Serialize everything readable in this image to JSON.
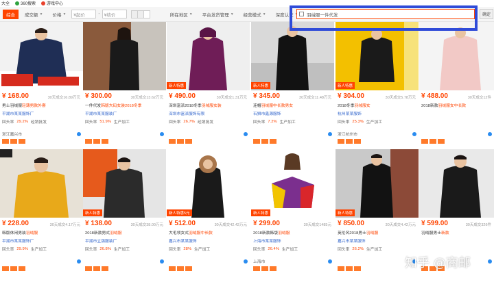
{
  "bookmarks": [
    {
      "label": "大全",
      "color": ""
    },
    {
      "label": "360搜索",
      "color": "#2fa33f"
    },
    {
      "label": "游戏中心",
      "color": "#e8412c"
    }
  ],
  "filters": {
    "sort_default": "综合",
    "sort_sales": "成交额",
    "sort_price": "价格",
    "price_from": "¥起价",
    "price_to": "¥结价",
    "location": "所在地区",
    "platform": "平台发货管理",
    "operation": "经营模式",
    "auth": "深度认证",
    "search_value": "羽绒服一件代发",
    "search_btn": "确定"
  },
  "products": [
    {
      "price": "¥ 168.00",
      "sales": "30天成交16.89万元",
      "title_a": "男士羽绒服",
      "title_b": "轻薄男款外套",
      "shop": "平湖市某某服饰厂",
      "repeat": "回头率",
      "rate": "29.2%",
      "type": "经销批发",
      "loc": "浙江嘉兴市",
      "badge": "",
      "img": "navy-jacket"
    },
    {
      "price": "¥ 300.00",
      "sales": "30天成交13.62万元",
      "title_a": "一件代发",
      "title_b": "韩版大码女装2018冬季",
      "shop": "平湖市某某服装厂",
      "repeat": "回头率",
      "rate": "51.9%",
      "type": "生产加工",
      "loc": "",
      "badge": "",
      "img": "black-coat-girl"
    },
    {
      "price": "¥ 490.00",
      "sales": "30天成交1.31万元",
      "title_a": "深圳富派2018冬季",
      "title_b": "羽绒服女装",
      "shop": "深圳市富派服饰有限",
      "repeat": "回头率",
      "rate": "26.7%",
      "type": "经销批发",
      "loc": "",
      "badge": "新人特惠",
      "img": "purple-parka"
    },
    {
      "price": "¥ 345.00",
      "sales": "30天成交11.48万元",
      "title_a": "连帽",
      "title_b": "羽绒服中长款男女",
      "shop": "石狮市鑫源服饰",
      "repeat": "回头率",
      "rate": "7.2%",
      "type": "生产加工",
      "loc": "",
      "badge": "新人特惠",
      "img": "black-long"
    },
    {
      "price": "¥ 304.00",
      "sales": "30天成交5.78万元",
      "title_a": "2018冬季",
      "title_b": "羽绒服女",
      "shop": "杭州某某服饰",
      "repeat": "回头率",
      "rate": "25.3%",
      "type": "生产加工",
      "loc": "浙江杭州市",
      "badge": "新人特惠",
      "img": "yellow-wall"
    },
    {
      "price": "¥ 488.00",
      "sales": "30天成交12件",
      "title_a": "2018新款",
      "title_b": "羽绒服女中长款",
      "shop": "",
      "repeat": "",
      "rate": "",
      "type": "",
      "loc": "",
      "badge": "",
      "img": "pink-coat"
    },
    {
      "price": "¥ 228.00",
      "sales": "30天成交4.17万元",
      "title_a": "韩版休闲男装",
      "title_b": "羽绒服",
      "shop": "平湖市某某服饰厂",
      "repeat": "回头率",
      "rate": "29.9%",
      "type": "生产加工",
      "loc": "",
      "badge": "",
      "img": "yellow-jacket"
    },
    {
      "price": "¥ 138.00",
      "sales": "30天成交38.00万元",
      "title_a": "2018新款男式",
      "title_b": "羽绒服",
      "shop": "平湖市立强服装厂",
      "repeat": "回头率",
      "rate": "26.8%",
      "type": "生产加工",
      "loc": "",
      "badge": "新人特惠",
      "img": "black-puffer"
    },
    {
      "price": "¥ 512.00",
      "sales": "30天成交42.42万元",
      "title_a": "大毛领女式",
      "title_b": "羽绒服中长款",
      "shop": "嘉兴市某某服饰",
      "repeat": "回头率",
      "rate": "28%",
      "type": "生产加工",
      "loc": "",
      "badge": "新人特惠5元",
      "img": "fur-hood"
    },
    {
      "price": "¥ 299.00",
      "sales": "30天成交1485元",
      "title_a": "2018新款韩版",
      "title_b": "羽绒服",
      "shop": "上海市某某服饰",
      "repeat": "回头率",
      "rate": "26.4%",
      "type": "生产加工",
      "loc": "上海市",
      "badge": "新人特惠",
      "img": "colorful-coat"
    },
    {
      "price": "¥ 850.00",
      "sales": "30天成交4.42万元",
      "title_a": "英伦风2018男士",
      "title_b": "羽绒服",
      "shop": "嘉兴市某某服饰",
      "repeat": "回头率",
      "rate": "26.2%",
      "type": "生产加工",
      "loc": "",
      "badge": "新人特惠",
      "img": "black-long-man"
    },
    {
      "price": "¥ 599.00",
      "sales": "30天成交326件",
      "title_a": "羽绒服男士",
      "title_b": "新款",
      "shop": "",
      "repeat": "",
      "rate": "",
      "type": "",
      "loc": "",
      "badge": "",
      "img": "man-coat"
    }
  ],
  "watermark": "知乎 @商邮"
}
